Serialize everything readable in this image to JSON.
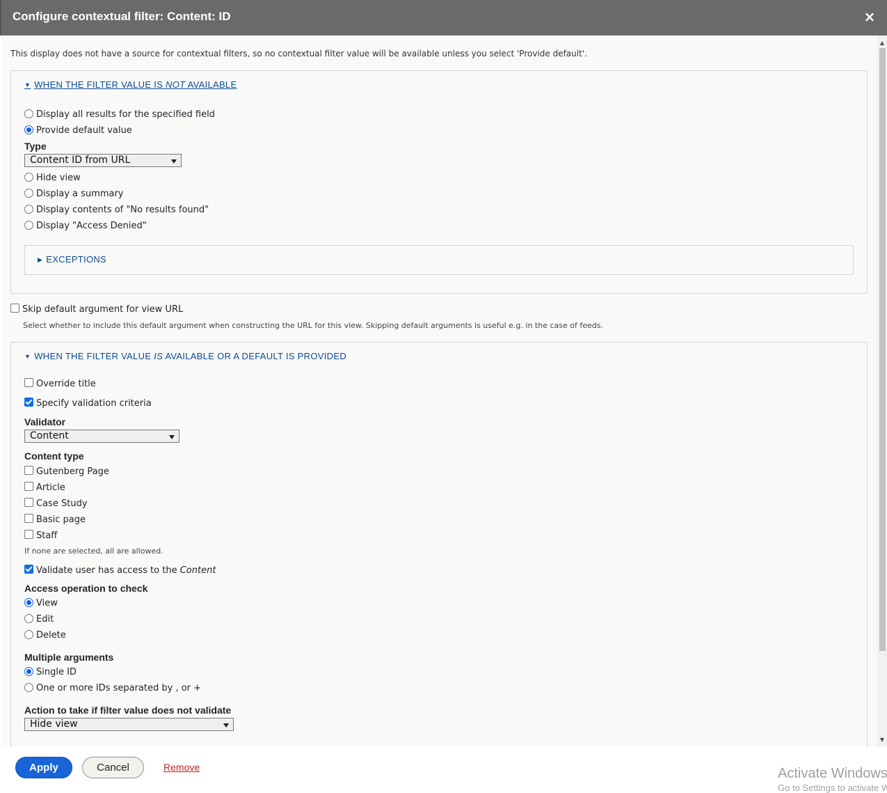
{
  "dialog": {
    "title": "Configure contextual filter: Content: ID",
    "close_label": "×"
  },
  "intro_text": "This display does not have a source for contextual filters, so no contextual filter value will be available unless you select 'Provide default'.",
  "not_available": {
    "legend_pre": "WHEN THE FILTER VALUE IS ",
    "legend_em": "NOT",
    "legend_post": " AVAILABLE",
    "options": [
      {
        "label": "Display all results for the specified field",
        "checked": false
      },
      {
        "label": "Provide default value",
        "checked": true
      }
    ],
    "type_label": "Type",
    "type_value": "Content ID from URL",
    "more_options": [
      {
        "label": "Hide view",
        "checked": false
      },
      {
        "label": "Display a summary",
        "checked": false
      },
      {
        "label": "Display contents of \"No results found\"",
        "checked": false
      },
      {
        "label": "Display \"Access Denied\"",
        "checked": false
      }
    ],
    "exceptions_label": "EXCEPTIONS"
  },
  "skip_default": {
    "label": "Skip default argument for view URL",
    "checked": false,
    "description": "Select whether to include this default argument when constructing the URL for this view. Skipping default arguments is useful e.g. in the case of feeds."
  },
  "available": {
    "legend_pre": "WHEN THE FILTER VALUE ",
    "legend_em": "IS",
    "legend_post": " AVAILABLE OR A DEFAULT IS PROVIDED",
    "override_title": {
      "label": "Override title",
      "checked": false
    },
    "specify_validation": {
      "label": "Specify validation criteria",
      "checked": true
    },
    "validator_label": "Validator",
    "validator_value": "Content",
    "content_type_label": "Content type",
    "content_types": [
      {
        "label": "Gutenberg Page",
        "checked": false
      },
      {
        "label": "Article",
        "checked": false
      },
      {
        "label": "Case Study",
        "checked": false
      },
      {
        "label": "Basic page",
        "checked": false
      },
      {
        "label": "Staff",
        "checked": false
      }
    ],
    "content_type_help": "If none are selected, all are allowed.",
    "validate_access_pre": "Validate user has access to the ",
    "validate_access_em": "Content",
    "validate_access_checked": true,
    "access_op_label": "Access operation to check",
    "access_ops": [
      {
        "label": "View",
        "checked": true
      },
      {
        "label": "Edit",
        "checked": false
      },
      {
        "label": "Delete",
        "checked": false
      }
    ],
    "multiple_label": "Multiple arguments",
    "multiple_options": [
      {
        "label": "Single ID",
        "checked": true
      },
      {
        "label": "One or more IDs separated by , or +",
        "checked": false
      }
    ],
    "fail_label": "Action to take if filter value does not validate",
    "fail_value": "Hide view"
  },
  "footer": {
    "apply": "Apply",
    "cancel": "Cancel",
    "remove": "Remove"
  },
  "watermark": {
    "line1": "Activate Windows",
    "line2": "Go to Settings to activate Windows."
  },
  "colors": {
    "titlebar": "#6a6a6a",
    "link": "#0b4a8f",
    "primary": "#1864d8",
    "danger": "#c41e1e"
  }
}
